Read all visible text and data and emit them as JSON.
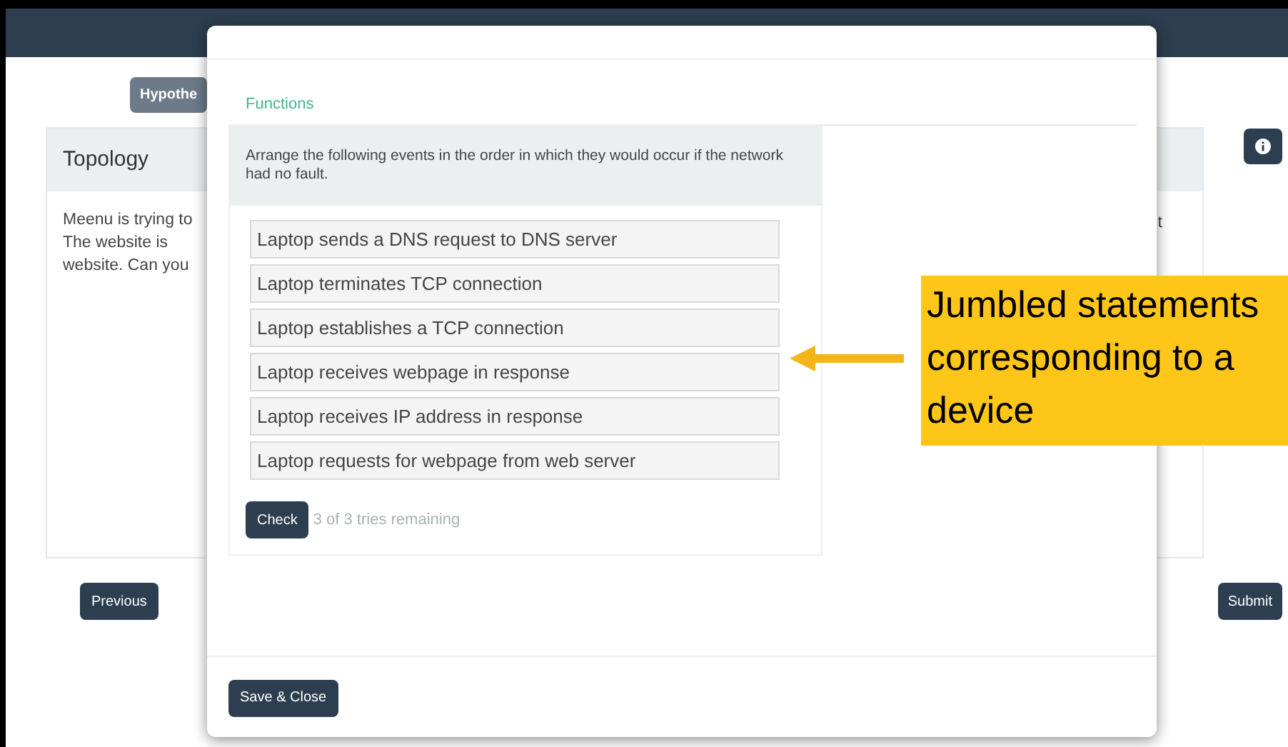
{
  "hypotheses_tab": {
    "label": "Hypothe"
  },
  "topology": {
    "title": "Topology",
    "lines": [
      "Meenu is trying to",
      "The website is",
      "website. Can you"
    ],
    "right_fragment": "t"
  },
  "nav": {
    "previous": "Previous",
    "submit": "Submit"
  },
  "modal": {
    "section_title": "Functions",
    "prompt": "Arrange the following events in the order in which they would occur if the network had no fault.",
    "items": [
      "Laptop sends a DNS request to DNS server",
      "Laptop terminates TCP connection",
      "Laptop establishes a TCP connection",
      "Laptop receives webpage in response",
      "Laptop receives IP address in response",
      "Laptop requests for webpage from web server"
    ],
    "check": "Check",
    "tries": "3 of 3 tries remaining",
    "save": "Save & Close"
  },
  "callout": {
    "text": "Jumbled statements corresponding to a device"
  }
}
